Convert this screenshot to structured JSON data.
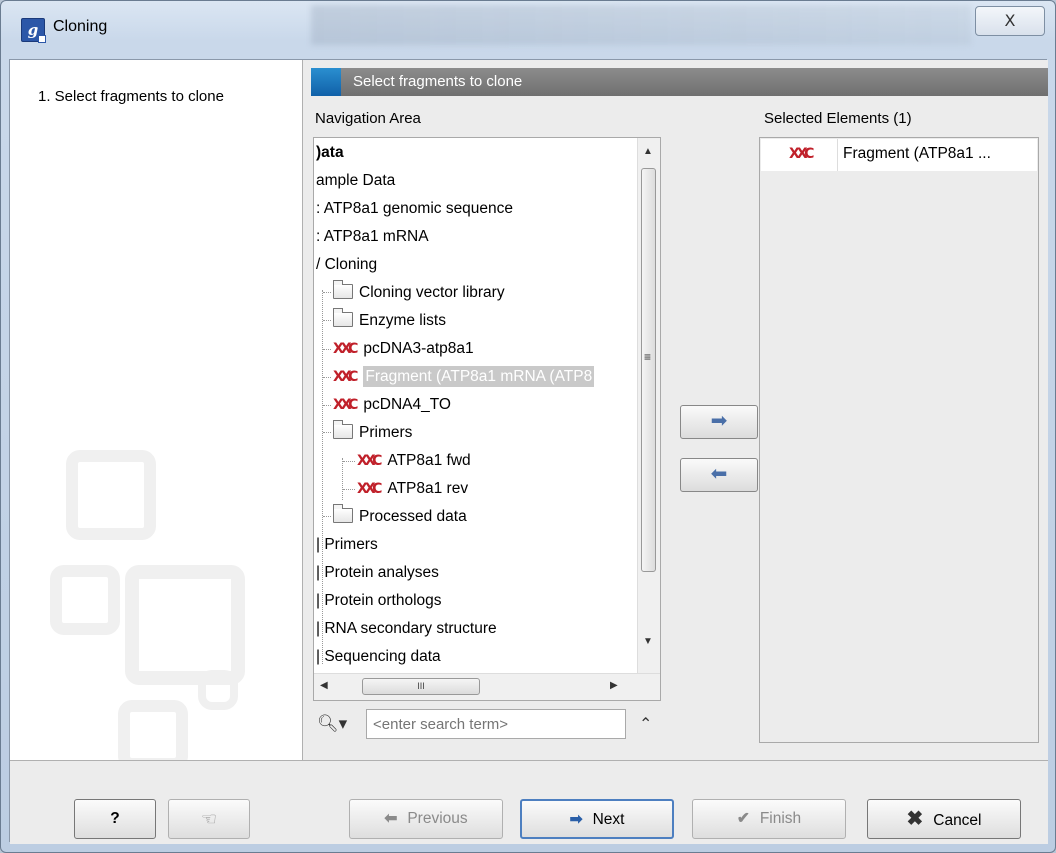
{
  "window": {
    "title": "Cloning",
    "app_icon": "g",
    "close_label": "X"
  },
  "steps": [
    {
      "label": "1.  Select fragments to clone"
    }
  ],
  "page": {
    "header": "Select fragments to clone",
    "navigation_label": "Navigation Area",
    "selected_label": "Selected Elements (1)"
  },
  "tree": [
    {
      "label": ")ata",
      "icon": "none",
      "bold": true
    },
    {
      "label": "ample Data",
      "icon": "none"
    },
    {
      "label": ": ATP8a1 genomic sequence",
      "icon": "none"
    },
    {
      "label": ": ATP8a1 mRNA",
      "icon": "none"
    },
    {
      "label": "/ Cloning",
      "icon": "none"
    },
    {
      "label": "Cloning vector library",
      "icon": "folder-icon"
    },
    {
      "label": "Enzyme lists",
      "icon": "folder-icon"
    },
    {
      "label": "pcDNA3-atp8a1",
      "icon": "sequence-icon"
    },
    {
      "label": "Fragment (ATP8a1 mRNA (ATP8",
      "icon": "sequence-icon",
      "selected": true
    },
    {
      "label": "pcDNA4_TO",
      "icon": "sequence-icon"
    },
    {
      "label": "Primers",
      "icon": "folder-icon"
    },
    {
      "label": "ATP8a1 fwd",
      "icon": "sequence-icon"
    },
    {
      "label": "ATP8a1 rev",
      "icon": "sequence-icon"
    },
    {
      "label": "Processed data",
      "icon": "folder-icon"
    },
    {
      "label": "| Primers",
      "icon": "none"
    },
    {
      "label": "| Protein analyses",
      "icon": "none"
    },
    {
      "label": "| Protein orthologs",
      "icon": "none"
    },
    {
      "label": "| RNA secondary structure",
      "icon": "none"
    },
    {
      "label": "| Sequencing data",
      "icon": "none"
    }
  ],
  "hscroll_grip": "III",
  "search": {
    "placeholder": "<enter search term>",
    "value": ""
  },
  "selected_elements": [
    {
      "label": "Fragment (ATP8a1 ...",
      "icon": "sequence-icon"
    }
  ],
  "buttons": {
    "help": "?",
    "previous": "Previous",
    "next": "Next",
    "finish": "Finish",
    "cancel": "Cancel"
  },
  "colors": {
    "sequence_icon": "#c0202a",
    "default_button_border": "#4d7fc0",
    "header_accent": "#1a73c0"
  }
}
